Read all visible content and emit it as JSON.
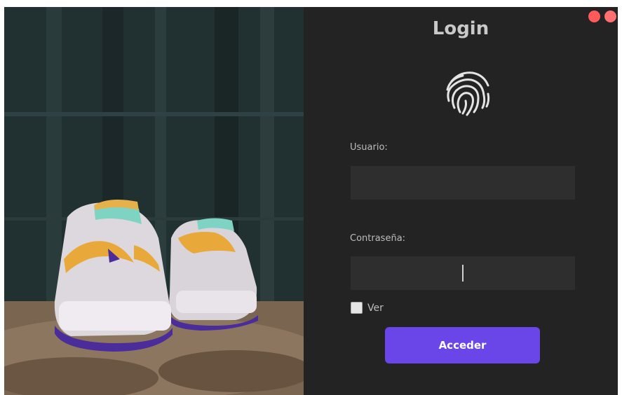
{
  "app": {
    "title": "Login"
  },
  "window_controls": {
    "items": [
      {
        "icon": "close-icon",
        "color": "#ff5a5a"
      },
      {
        "icon": "minimize-icon",
        "color": "#ff6f6f"
      }
    ]
  },
  "form": {
    "fingerprint_icon": "fingerprint-icon",
    "username": {
      "label": "Usuario:",
      "value": "",
      "placeholder": ""
    },
    "password": {
      "label": "Contraseña:",
      "value": "",
      "placeholder": ""
    },
    "show_password": {
      "label": "Ver",
      "checked": false
    },
    "submit_label": "Acceder"
  },
  "colors": {
    "panel_bg": "#232323",
    "field_bg": "#2e2e2e",
    "accent": "#6a46e8",
    "window_control": "#ff5a5a"
  }
}
